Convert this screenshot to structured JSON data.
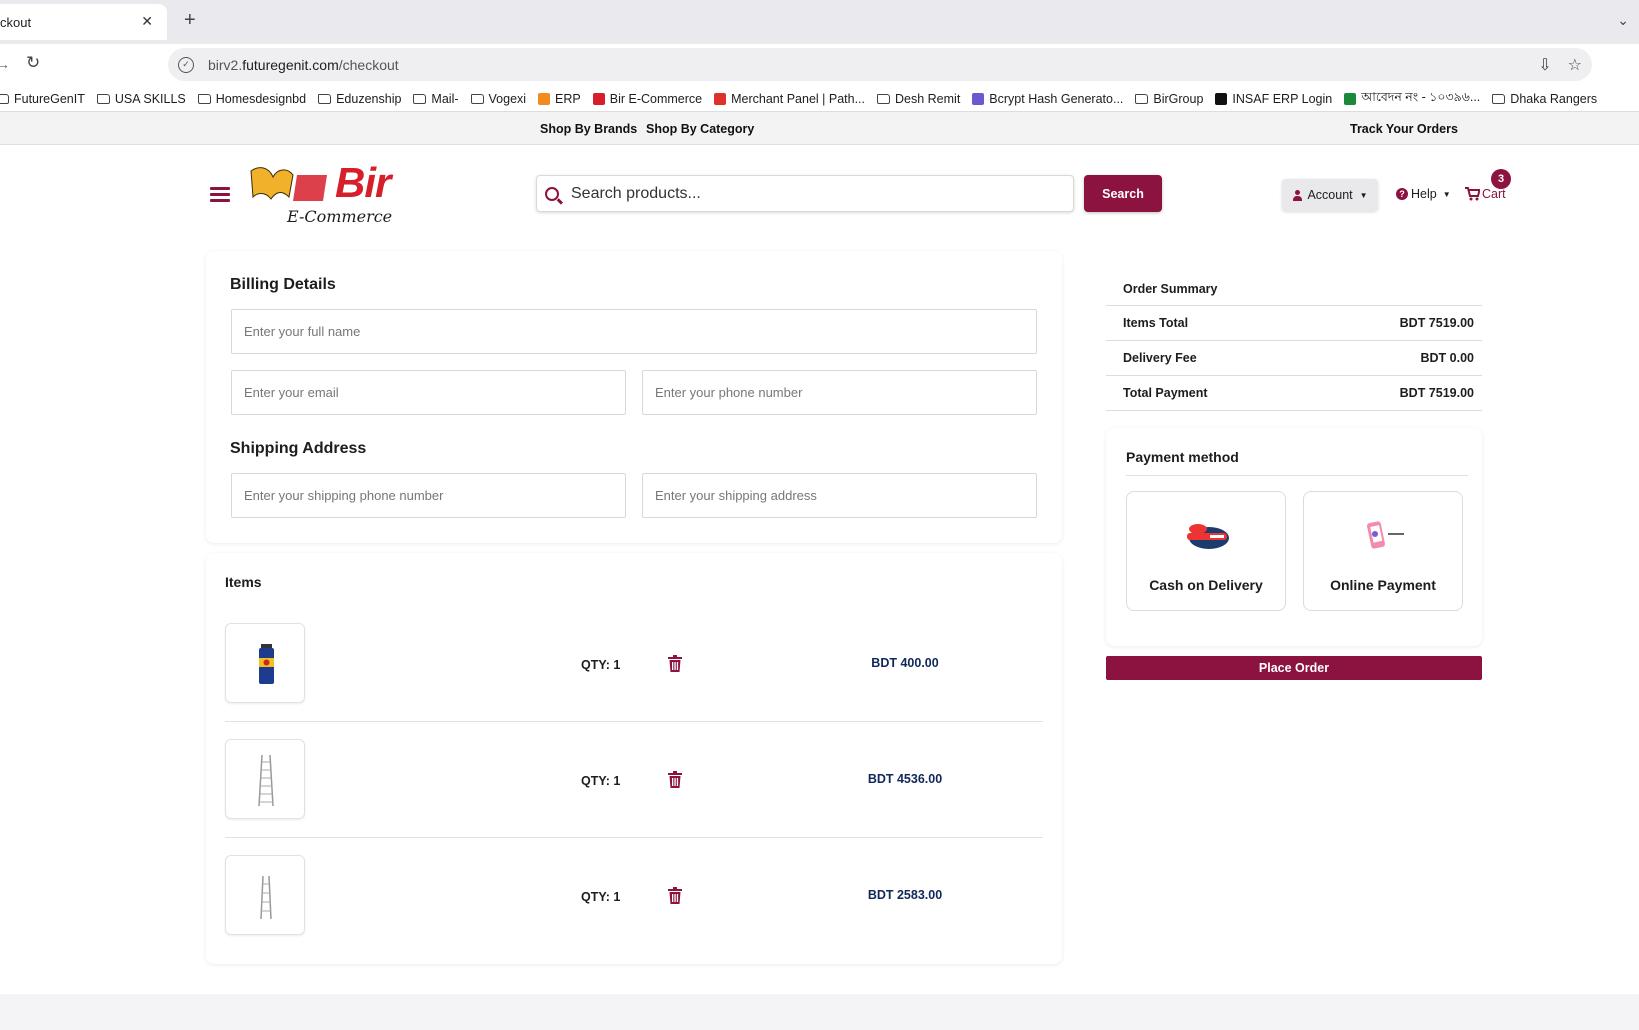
{
  "browser": {
    "tab_title": "ckout",
    "tab_close": "✕",
    "new_tab": "+",
    "tabs_menu": "⌄",
    "url_domain": "birv2.futuregenit.com",
    "url_path": "/checkout",
    "url_prefix": "birv2.",
    "url_main": "futuregenit.com",
    "bookmarks": [
      {
        "label": "FutureGenIT",
        "icon": "folder-icon"
      },
      {
        "label": "USA SKILLS",
        "icon": "folder-icon"
      },
      {
        "label": "Homesdesignbd",
        "icon": "folder-icon"
      },
      {
        "label": "Eduzenship",
        "icon": "folder-icon"
      },
      {
        "label": "Mail-",
        "icon": "folder-icon"
      },
      {
        "label": "Vogexi",
        "icon": "folder-icon"
      },
      {
        "label": "ERP",
        "icon": "erp-favicon"
      },
      {
        "label": "Bir E-Commerce",
        "icon": "bir-favicon"
      },
      {
        "label": "Merchant Panel | Path...",
        "icon": "pathao-favicon"
      },
      {
        "label": "Desh Remit",
        "icon": "folder-icon"
      },
      {
        "label": "Bcrypt Hash Generato...",
        "icon": "bcrypt-favicon"
      },
      {
        "label": "BirGroup",
        "icon": "folder-icon"
      },
      {
        "label": "INSAF ERP Login",
        "icon": "insaf-favicon"
      },
      {
        "label": "আবেদন নং - ১০৩৯৬...",
        "icon": "bd-gov-favicon"
      },
      {
        "label": "Dhaka Rangers",
        "icon": "folder-icon"
      }
    ]
  },
  "topstrip": {
    "shop_by_brands": "Shop By Brands",
    "shop_by_category": "Shop By Category",
    "track_orders": "Track Your Orders"
  },
  "header": {
    "logo_text": "Bir",
    "logo_sub": "E-Commerce",
    "search_placeholder": "Search products...",
    "search_button": "Search",
    "account": "Account",
    "help": "Help",
    "cart": "Cart",
    "cart_count": "3",
    "brand_color": "#8c1240"
  },
  "billing": {
    "title": "Billing Details",
    "full_name_placeholder": "Enter your full name",
    "email_placeholder": "Enter your email",
    "phone_placeholder": "Enter your phone number"
  },
  "shipping": {
    "title": "Shipping Address",
    "phone_placeholder": "Enter your shipping phone number",
    "address_placeholder": "Enter your shipping address"
  },
  "items": {
    "title": "Items",
    "rows": [
      {
        "qty": "QTY: 1",
        "price": "BDT 400.00",
        "image": "spray-can-product"
      },
      {
        "qty": "QTY: 1",
        "price": "BDT 4536.00",
        "image": "ladder-product"
      },
      {
        "qty": "QTY: 1",
        "price": "BDT 2583.00",
        "image": "ladder-product"
      }
    ]
  },
  "summary": {
    "title": "Order Summary",
    "items_total_label": "Items Total",
    "items_total": "BDT 7519.00",
    "delivery_label": "Delivery Fee",
    "delivery": "BDT 0.00",
    "total_label": "Total Payment",
    "total": "BDT 7519.00"
  },
  "payment": {
    "title": "Payment method",
    "cod": "Cash on Delivery",
    "online": "Online Payment",
    "place_order": "Place Order"
  }
}
